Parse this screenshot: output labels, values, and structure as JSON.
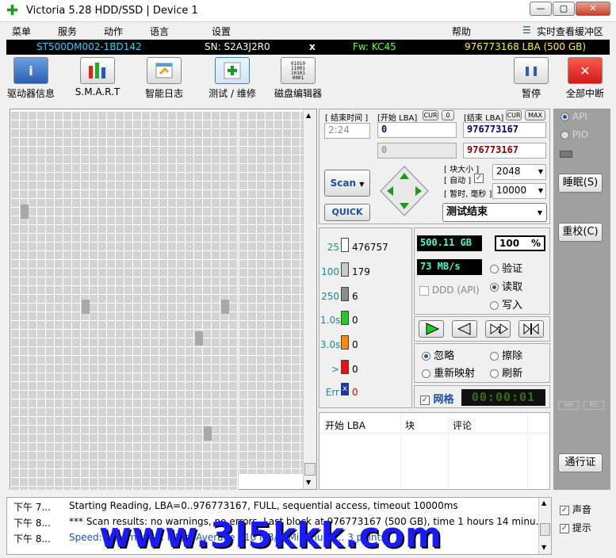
{
  "window": {
    "title": "Victoria 5.28 HDD/SSD | Device 1",
    "min_icon": "minimize-icon",
    "max_icon": "maximize-icon",
    "close_icon": "close-icon"
  },
  "menu": {
    "items": [
      "菜单",
      "服务",
      "动作",
      "语言",
      "设置"
    ],
    "help": "帮助",
    "cache_view": "实时查看缓冲区"
  },
  "device": {
    "model": "ST500DM002-1BD142",
    "serial": "SN: S2A3J2R0",
    "close_mark": "x",
    "firmware": "Fw: KC45",
    "capacity": "976773168 LBA (500 GB)"
  },
  "toolbar": {
    "drive_info": "驱动器信息",
    "smart": "S.M.A.R.T",
    "smart_log": "智能日志",
    "test_repair": "测试 / 维修",
    "disk_editor": "磁盘编辑器",
    "pause": "暂停",
    "abort": "全部中断",
    "editor_icon_text": "01010\n11001\n10101\n0001"
  },
  "scan_params": {
    "end_time_label": "[ 结束时间 ]",
    "start_lba_label": "[开始 LBA]",
    "cur_label": "CUR",
    "zero_label": "0",
    "end_lba_label": "[结束 LBA]",
    "max_label": "MAX",
    "time_value": "2:24",
    "start_lba": "0",
    "end_lba": "976773167",
    "start_lba_2": "0",
    "end_lba_2": "976773167",
    "block_size_label": "[ 块大小 ]",
    "auto_label": "[ 自动 ]",
    "block_size": "2048",
    "timeout_label": "[ 暂时, 毫秒 ]",
    "timeout": "10000",
    "scan_button": "Scan",
    "quick_button": "QUICK",
    "mode_select": "测试结束"
  },
  "legend": [
    {
      "label": "25",
      "count": "476757",
      "color": "#ffffff"
    },
    {
      "label": "100",
      "count": "179",
      "color": "#c8c8c8"
    },
    {
      "label": "250",
      "count": "6",
      "color": "#8c8c8c"
    },
    {
      "label": "1.0s",
      "count": "0",
      "color": "#22cc22"
    },
    {
      "label": "3.0s",
      "count": "0",
      "color": "#ff8800"
    },
    {
      "label": ">",
      "count": "0",
      "color": "#ee1111"
    },
    {
      "label": "Err",
      "count": "0",
      "color": "#1133cc"
    }
  ],
  "stats": {
    "size": "500.11 GB",
    "percent": "100",
    "percent_sign": "%",
    "speed": "73 MB/s",
    "ddd_api": "DDD (API)",
    "verify": "验证",
    "read": "读取",
    "write": "写入",
    "ignore": "忽略",
    "erase": "擦除",
    "remap": "重新映射",
    "refresh": "刷新",
    "grid_label": "网格",
    "timer": "00:00:01"
  },
  "table": {
    "columns": [
      "开始 LBA",
      "块",
      "评论"
    ]
  },
  "sidebar": {
    "api": "API",
    "pio": "PIO",
    "sleep": "睡眠(S)",
    "recalibrate": "重校(C)",
    "wr": "WR",
    "rd": "RD",
    "passport": "通行证"
  },
  "log": [
    {
      "time": "下午 7...",
      "text": "Starting Reading, LBA=0..976773167, FULL, sequential access, timeout 10000ms"
    },
    {
      "time": "下午 8...",
      "text": "*** Scan results: no warnings, no errors. Last block at 976773167 (500 GB), time 1 hours 14 minu..."
    },
    {
      "time": "下午 8...",
      "text": "Speed: Maximum ... MB/s. Average 110 MB/s. Minimum ... 3 points"
    }
  ],
  "bottom_right": {
    "sound": "声音",
    "hints": "提示"
  },
  "watermark": "www.3l5kkk.com",
  "colors": {
    "info_bg": "#000000",
    "model_color": "#30d0ff",
    "firmware_color": "#66ff44",
    "capacity_color": "#ffee44",
    "lba_blue": "#000080",
    "lba_red": "#8b0000",
    "stat_bg": "#000000",
    "stat_fg": "#44ffcc"
  }
}
